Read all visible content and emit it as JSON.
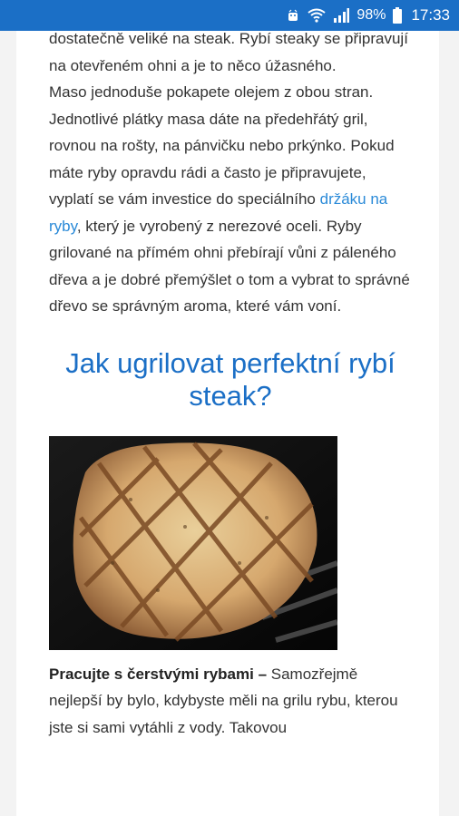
{
  "status": {
    "battery": "98%",
    "time": "17:33"
  },
  "article": {
    "para1": "dostatečně veliké na steak. Rybí steaky se připravují na otevřeném ohni a je to něco úžasného.",
    "para2_before": "Maso jednoduše pokapete olejem z obou stran. Jednotlivé plátky masa dáte na předehřátý gril, rovnou na rošty, na pánvičku nebo prkýnko. Pokud máte ryby opravdu rádi a často je připravujete, vyplatí se vám investice do speciálního ",
    "para2_link": "držáku na ryby",
    "para2_after": ", který je vyrobený z nerezové oceli. Ryby grilované na přímém ohni přebírají vůni z páleného dřeva a je dobré přemýšlet o tom a vybrat to správné dřevo se správným aroma, které vám voní.",
    "heading": "Jak ugrilovat perfektní rybí steak?",
    "para3_bold": "Pracujte s čerstvými rybami –",
    "para3_text": " Samozřejmě nejlepší by bylo, kdybyste měli na grilu rybu, kterou jste si sami vytáhli z vody. Takovou"
  },
  "icons": {
    "notification": "android-icon",
    "wifi": "wifi-icon",
    "signal": "signal-icon",
    "battery": "battery-icon"
  },
  "colors": {
    "statusbar": "#1b6fc6",
    "heading": "#1b6fc6",
    "link": "#2a8ad8"
  }
}
